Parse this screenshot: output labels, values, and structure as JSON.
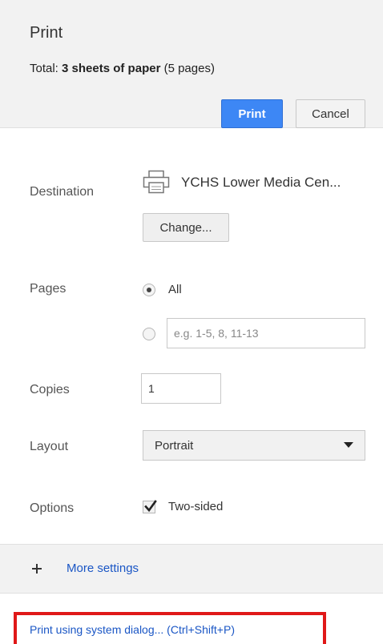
{
  "dialog": {
    "title": "Print",
    "summary_prefix": "Total: ",
    "summary_bold": "3 sheets of paper",
    "summary_suffix": " (5 pages)"
  },
  "buttons": {
    "print": "Print",
    "cancel": "Cancel",
    "change": "Change..."
  },
  "destination": {
    "label": "Destination",
    "printer_name": "YCHS Lower Media Cen...",
    "icon": "printer-icon"
  },
  "pages": {
    "label": "Pages",
    "options": [
      {
        "label": "All",
        "selected": true
      },
      {
        "label": "",
        "selected": false
      }
    ],
    "custom_placeholder": "e.g. 1-5, 8, 11-13",
    "custom_value": ""
  },
  "copies": {
    "label": "Copies",
    "value": "1"
  },
  "layout": {
    "label": "Layout",
    "selected": "Portrait"
  },
  "options": {
    "label": "Options",
    "two_sided_label": "Two-sided",
    "two_sided_checked": true
  },
  "more_settings": {
    "label": "More settings",
    "icon": "plus-icon"
  },
  "system_dialog": {
    "label": "Print using system dialog... (Ctrl+Shift+P)",
    "highlight_color": "#e01818"
  },
  "colors": {
    "accent": "#3d87f5",
    "link": "#1a56c5",
    "header_bg": "#f2f2f2"
  }
}
